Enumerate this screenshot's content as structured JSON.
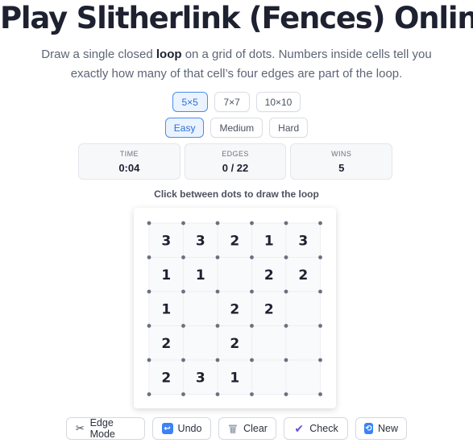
{
  "title": "Play Slitherlink (Fences) Online",
  "description": {
    "part1": "Draw a single closed ",
    "bold": "loop",
    "part2": " on a grid of dots. Numbers inside cells tell you exactly how many of that cell’s four edges are part of the loop."
  },
  "sizes": [
    {
      "label": "5×5",
      "active": true
    },
    {
      "label": "7×7",
      "active": false
    },
    {
      "label": "10×10",
      "active": false
    }
  ],
  "difficulties": [
    {
      "label": "Easy",
      "active": true
    },
    {
      "label": "Medium",
      "active": false
    },
    {
      "label": "Hard",
      "active": false
    }
  ],
  "stats": {
    "time_label": "TIME",
    "time_value": "0:04",
    "edges_label": "EDGES",
    "edges_value": "0 / 22",
    "wins_label": "WINS",
    "wins_value": "5"
  },
  "hint": "Click between dots to draw the loop",
  "grid": {
    "rows": 5,
    "cols": 5,
    "cells": [
      [
        "3",
        "3",
        "2",
        "1",
        "3"
      ],
      [
        "1",
        "1",
        "",
        "2",
        "2"
      ],
      [
        "1",
        "",
        "2",
        "2",
        ""
      ],
      [
        "2",
        "",
        "2",
        "",
        ""
      ],
      [
        "2",
        "3",
        "1",
        "",
        ""
      ]
    ]
  },
  "buttons": {
    "edge_mode": "Edge Mode",
    "undo": "Undo",
    "clear": "Clear",
    "check": "Check",
    "new": "New"
  },
  "icons": {
    "edge_mode": "scissors-icon",
    "undo": "undo-icon",
    "clear": "trash-icon",
    "check": "checkmark-icon",
    "new": "new-puzzle-icon"
  },
  "colors": {
    "accent": "#2b6fd6",
    "dot": "#6b7080",
    "number": "#1d2130"
  }
}
